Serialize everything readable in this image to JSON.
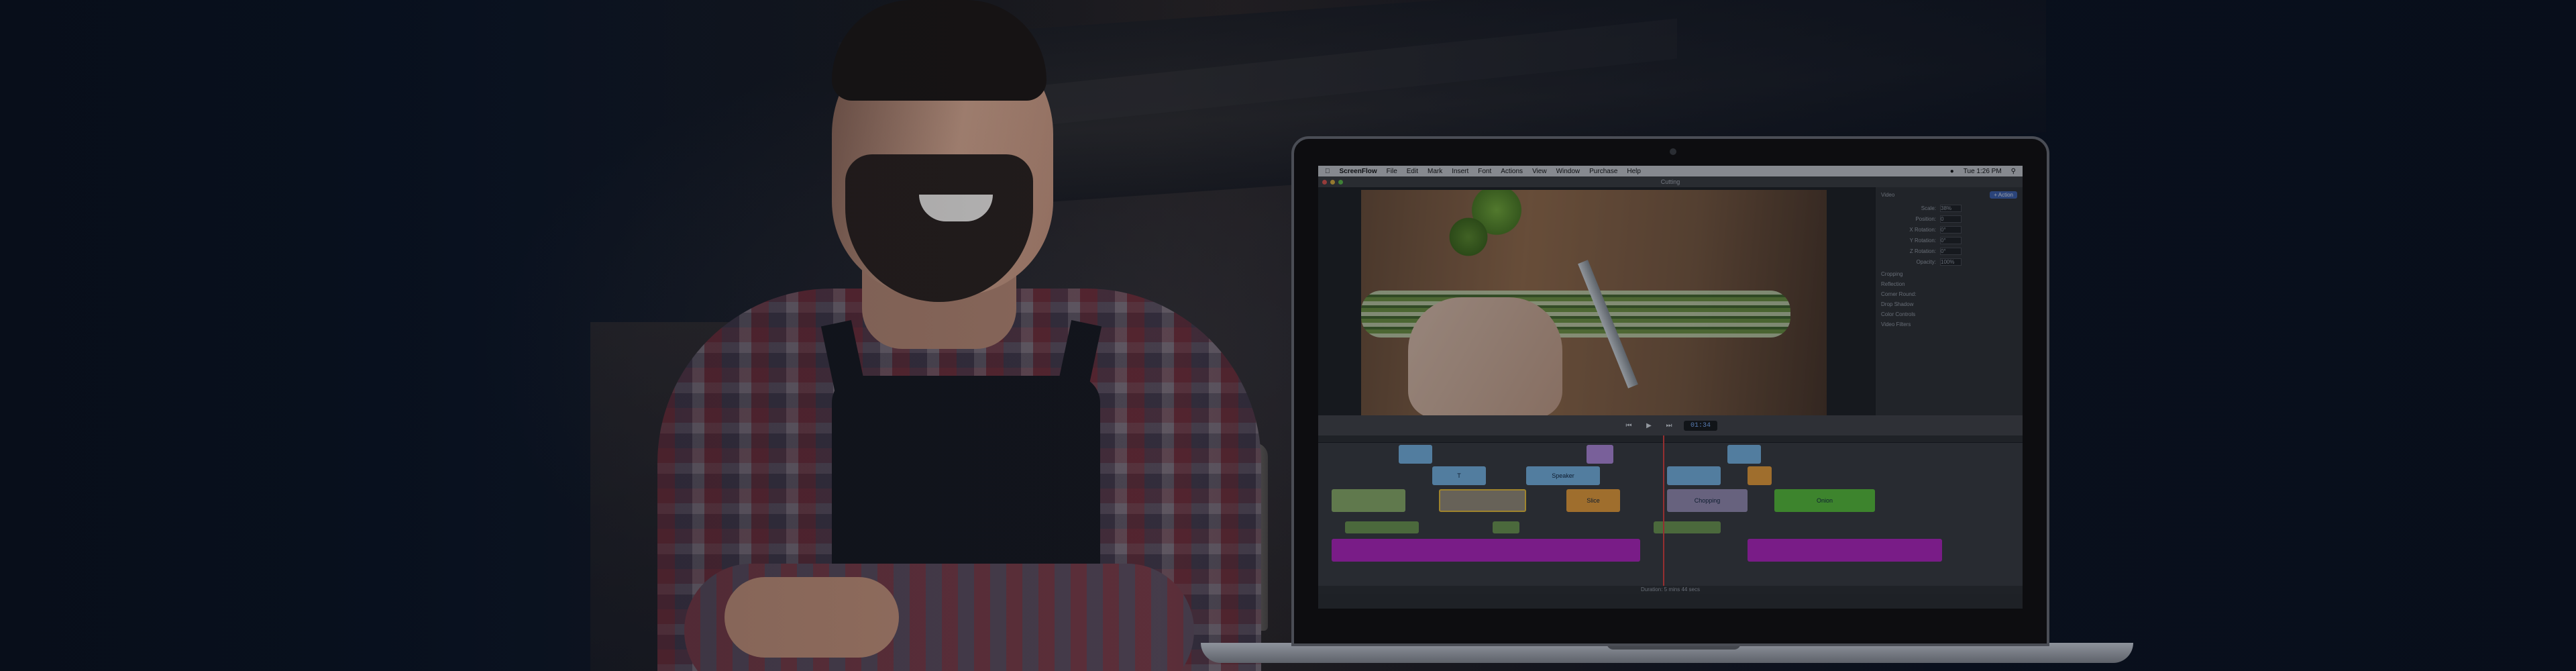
{
  "app": {
    "name": "ScreenFlow",
    "menus": [
      "File",
      "Edit",
      "Mark",
      "Insert",
      "Font",
      "Actions",
      "View",
      "Window",
      "Purchase",
      "Help"
    ],
    "clock": "Tue 1:26 PM",
    "document_title": "Cutting"
  },
  "inspector": {
    "section_video": "Video",
    "action_button": "+ Action",
    "rows": [
      {
        "label": "Scale:",
        "value": "38%"
      },
      {
        "label": "Position:",
        "value": "0"
      },
      {
        "label": "X Rotation:",
        "value": "0°"
      },
      {
        "label": "Y Rotation:",
        "value": "0°"
      },
      {
        "label": "Z Rotation:",
        "value": "0°"
      },
      {
        "label": "Opacity:",
        "value": "100%"
      }
    ],
    "section_cropping": "Cropping",
    "reflection_label": "Reflection",
    "corner_round_label": "Corner Round:",
    "drop_shadow_label": "Drop Shadow",
    "color_controls_label": "Color Controls",
    "video_filters_label": "Video Filters"
  },
  "transport": {
    "timecode": "01:34"
  },
  "timeline": {
    "duration_text": "Duration: 5 mins 44 secs",
    "clips": [
      {
        "label": "T",
        "color": "#7ab8e8"
      },
      {
        "label": "Speaker",
        "color": "#7ab8e8"
      },
      {
        "label": "Slice",
        "color": "#f0a23a"
      },
      {
        "label": "Chopping",
        "color": "#9a8fb5"
      },
      {
        "label": "Onion",
        "color": "#59c43a"
      }
    ]
  },
  "colors": {
    "accent": "#3e62b0",
    "playhead": "#e0413e",
    "audio": "#b524c4",
    "green_clip": "#59c43a",
    "blue_clip": "#7ab8e8",
    "orange_clip": "#f0a23a"
  }
}
